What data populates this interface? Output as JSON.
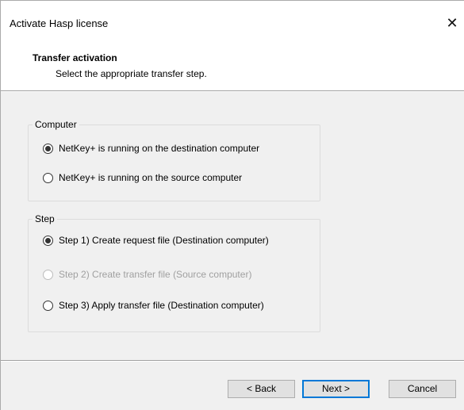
{
  "window": {
    "title": "Activate Hasp license",
    "close_glyph": "✕"
  },
  "header": {
    "title": "Transfer activation",
    "subtitle": "Select the appropriate transfer step."
  },
  "computer_group": {
    "legend": "Computer",
    "options": [
      {
        "label": "NetKey+ is running on the destination computer",
        "checked": true,
        "enabled": true
      },
      {
        "label": "NetKey+ is running on the source computer",
        "checked": false,
        "enabled": true
      }
    ]
  },
  "step_group": {
    "legend": "Step",
    "options": [
      {
        "label": "Step 1) Create request file (Destination computer)",
        "checked": true,
        "enabled": true
      },
      {
        "label": "Step 2) Create transfer file (Source computer)",
        "checked": false,
        "enabled": false
      },
      {
        "label": "Step 3) Apply transfer file (Destination computer)",
        "checked": false,
        "enabled": true
      }
    ]
  },
  "buttons": {
    "back": "< Back",
    "next": "Next >",
    "cancel": "Cancel"
  }
}
